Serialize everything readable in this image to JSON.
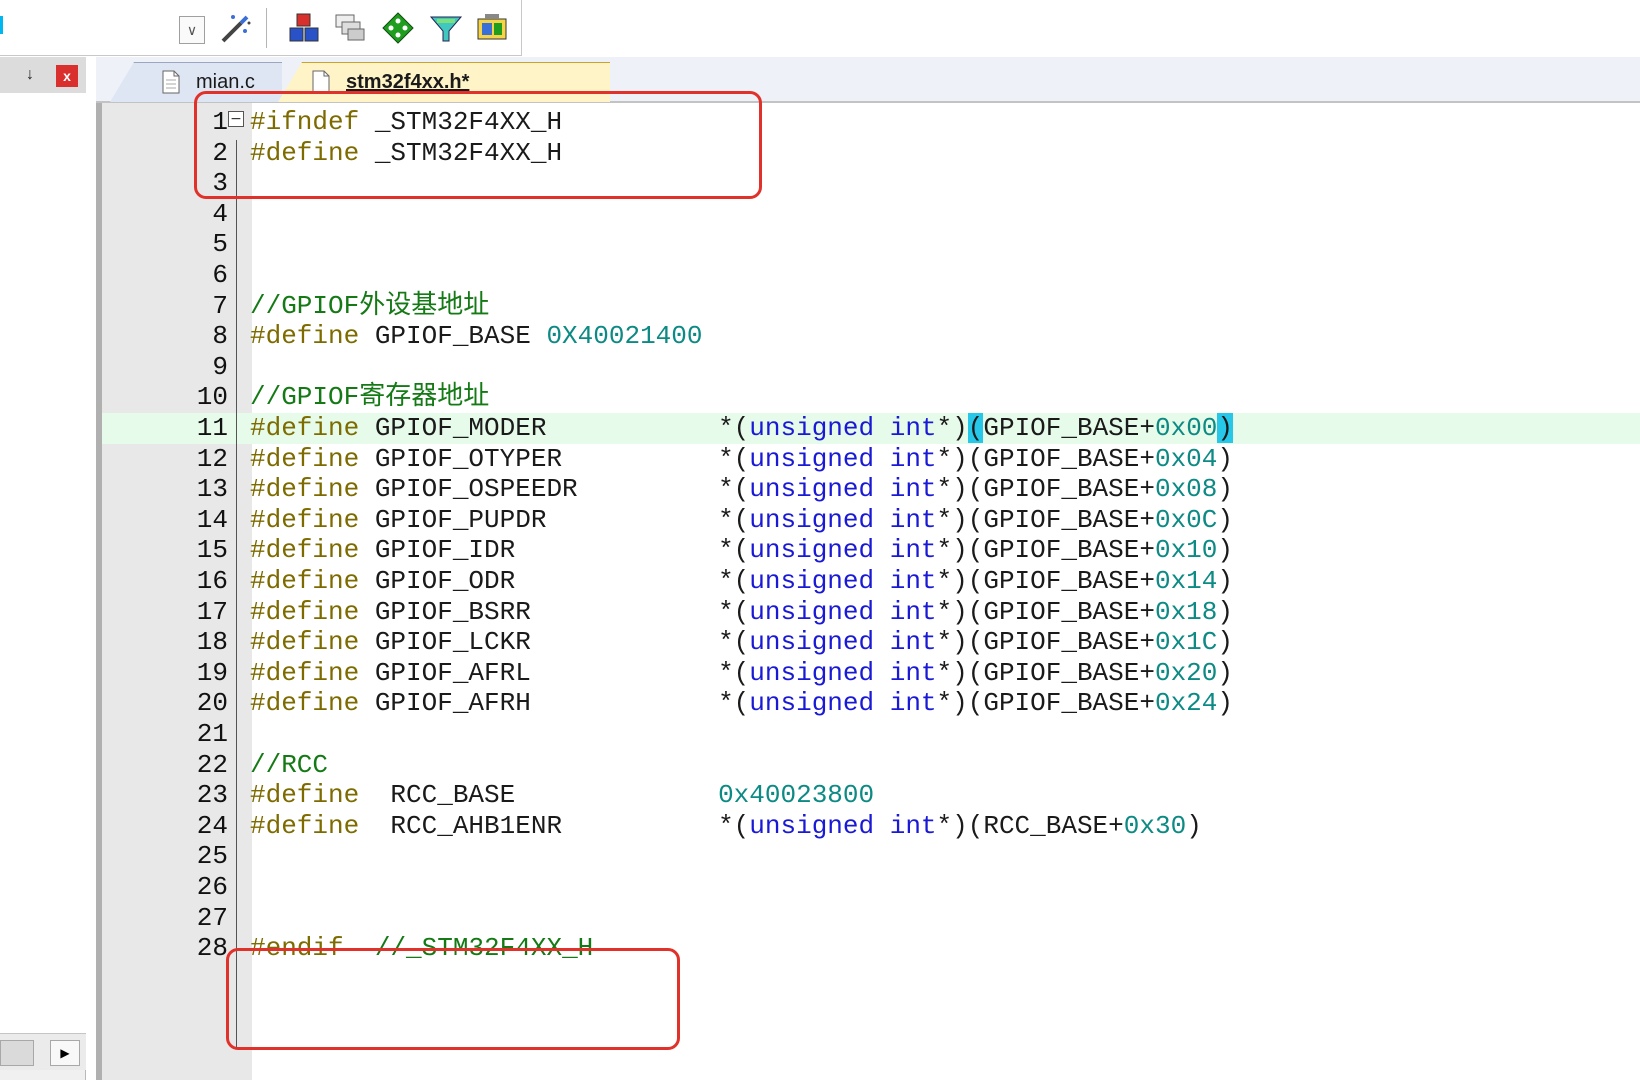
{
  "toolbar": {
    "icons": [
      "dropdown-chevron-icon",
      "magic-wand-icon",
      "blocks-icon",
      "windows-icon",
      "diamond-icon",
      "funnel-icon",
      "device-icon"
    ]
  },
  "left_panel": {
    "pin_glyph": "↓",
    "close_glyph": "x",
    "scroll_arrow": "▶"
  },
  "tabs": [
    {
      "label": "mian.c",
      "active": false
    },
    {
      "label": "stm32f4xx.h*",
      "active": true
    }
  ],
  "editor": {
    "highlight_line": 11,
    "lines": [
      {
        "n": "1",
        "parts": [
          [
            "pp",
            "#ifndef"
          ],
          [
            "t",
            " _STM32F4XX_H"
          ]
        ]
      },
      {
        "n": "2",
        "parts": [
          [
            "pp",
            "#define"
          ],
          [
            "t",
            " _STM32F4XX_H"
          ]
        ]
      },
      {
        "n": "3",
        "parts": []
      },
      {
        "n": "4",
        "parts": []
      },
      {
        "n": "5",
        "parts": []
      },
      {
        "n": "6",
        "parts": []
      },
      {
        "n": "7",
        "parts": [
          [
            "cmt",
            "//GPIOF外设基地址"
          ]
        ]
      },
      {
        "n": "8",
        "parts": [
          [
            "pp",
            "#define"
          ],
          [
            "t",
            " GPIOF_BASE "
          ],
          [
            "num",
            "0X40021400"
          ]
        ]
      },
      {
        "n": "9",
        "parts": []
      },
      {
        "n": "10",
        "parts": [
          [
            "cmt",
            "//GPIOF寄存器地址"
          ]
        ]
      },
      {
        "n": "11",
        "parts": [
          [
            "pp",
            "#define"
          ],
          [
            "t",
            " GPIOF_MODER           *("
          ],
          [
            "type",
            "unsigned int"
          ],
          [
            "t",
            "*)"
          ],
          [
            "hl",
            "("
          ],
          [
            "t",
            "GPIOF_BASE+"
          ],
          [
            "num",
            "0x00"
          ],
          [
            "hl",
            ")"
          ]
        ]
      },
      {
        "n": "12",
        "parts": [
          [
            "pp",
            "#define"
          ],
          [
            "t",
            " GPIOF_OTYPER          *("
          ],
          [
            "type",
            "unsigned int"
          ],
          [
            "t",
            "*)(GPIOF_BASE+"
          ],
          [
            "num",
            "0x04"
          ],
          [
            "t",
            ")"
          ]
        ]
      },
      {
        "n": "13",
        "parts": [
          [
            "pp",
            "#define"
          ],
          [
            "t",
            " GPIOF_OSPEEDR         *("
          ],
          [
            "type",
            "unsigned int"
          ],
          [
            "t",
            "*)(GPIOF_BASE+"
          ],
          [
            "num",
            "0x08"
          ],
          [
            "t",
            ")"
          ]
        ]
      },
      {
        "n": "14",
        "parts": [
          [
            "pp",
            "#define"
          ],
          [
            "t",
            " GPIOF_PUPDR           *("
          ],
          [
            "type",
            "unsigned int"
          ],
          [
            "t",
            "*)(GPIOF_BASE+"
          ],
          [
            "num",
            "0x0C"
          ],
          [
            "t",
            ")"
          ]
        ]
      },
      {
        "n": "15",
        "parts": [
          [
            "pp",
            "#define"
          ],
          [
            "t",
            " GPIOF_IDR             *("
          ],
          [
            "type",
            "unsigned int"
          ],
          [
            "t",
            "*)(GPIOF_BASE+"
          ],
          [
            "num",
            "0x10"
          ],
          [
            "t",
            ")"
          ]
        ]
      },
      {
        "n": "16",
        "parts": [
          [
            "pp",
            "#define"
          ],
          [
            "t",
            " GPIOF_ODR             *("
          ],
          [
            "type",
            "unsigned int"
          ],
          [
            "t",
            "*)(GPIOF_BASE+"
          ],
          [
            "num",
            "0x14"
          ],
          [
            "t",
            ")"
          ]
        ]
      },
      {
        "n": "17",
        "parts": [
          [
            "pp",
            "#define"
          ],
          [
            "t",
            " GPIOF_BSRR            *("
          ],
          [
            "type",
            "unsigned int"
          ],
          [
            "t",
            "*)(GPIOF_BASE+"
          ],
          [
            "num",
            "0x18"
          ],
          [
            "t",
            ")"
          ]
        ]
      },
      {
        "n": "18",
        "parts": [
          [
            "pp",
            "#define"
          ],
          [
            "t",
            " GPIOF_LCKR            *("
          ],
          [
            "type",
            "unsigned int"
          ],
          [
            "t",
            "*)(GPIOF_BASE+"
          ],
          [
            "num",
            "0x1C"
          ],
          [
            "t",
            ")"
          ]
        ]
      },
      {
        "n": "19",
        "parts": [
          [
            "pp",
            "#define"
          ],
          [
            "t",
            " GPIOF_AFRL            *("
          ],
          [
            "type",
            "unsigned int"
          ],
          [
            "t",
            "*)(GPIOF_BASE+"
          ],
          [
            "num",
            "0x20"
          ],
          [
            "t",
            ")"
          ]
        ]
      },
      {
        "n": "20",
        "parts": [
          [
            "pp",
            "#define"
          ],
          [
            "t",
            " GPIOF_AFRH            *("
          ],
          [
            "type",
            "unsigned int"
          ],
          [
            "t",
            "*)(GPIOF_BASE+"
          ],
          [
            "num",
            "0x24"
          ],
          [
            "t",
            ")"
          ]
        ]
      },
      {
        "n": "21",
        "parts": []
      },
      {
        "n": "22",
        "parts": [
          [
            "cmt",
            "//RCC"
          ]
        ]
      },
      {
        "n": "23",
        "parts": [
          [
            "pp",
            "#define"
          ],
          [
            "t",
            "  RCC_BASE             "
          ],
          [
            "num",
            "0x40023800"
          ]
        ]
      },
      {
        "n": "24",
        "parts": [
          [
            "pp",
            "#define"
          ],
          [
            "t",
            "  RCC_AHB1ENR          *("
          ],
          [
            "type",
            "unsigned int"
          ],
          [
            "t",
            "*)(RCC_BASE+"
          ],
          [
            "num",
            "0x30"
          ],
          [
            "t",
            ")"
          ]
        ]
      },
      {
        "n": "25",
        "parts": []
      },
      {
        "n": "26",
        "parts": []
      },
      {
        "n": "27",
        "parts": []
      },
      {
        "n": "28",
        "parts": [
          [
            "pp",
            "#endif"
          ],
          [
            "t",
            "  "
          ],
          [
            "cmt",
            "//_STM32F4XX_H"
          ]
        ]
      }
    ]
  },
  "colors": {
    "preprocessor": "#7d6b00",
    "type_keyword": "#1a1ad6",
    "number": "#0d8a84",
    "comment": "#157a16",
    "annotation": "#e0312b",
    "current_line": "#e6fbe9"
  }
}
